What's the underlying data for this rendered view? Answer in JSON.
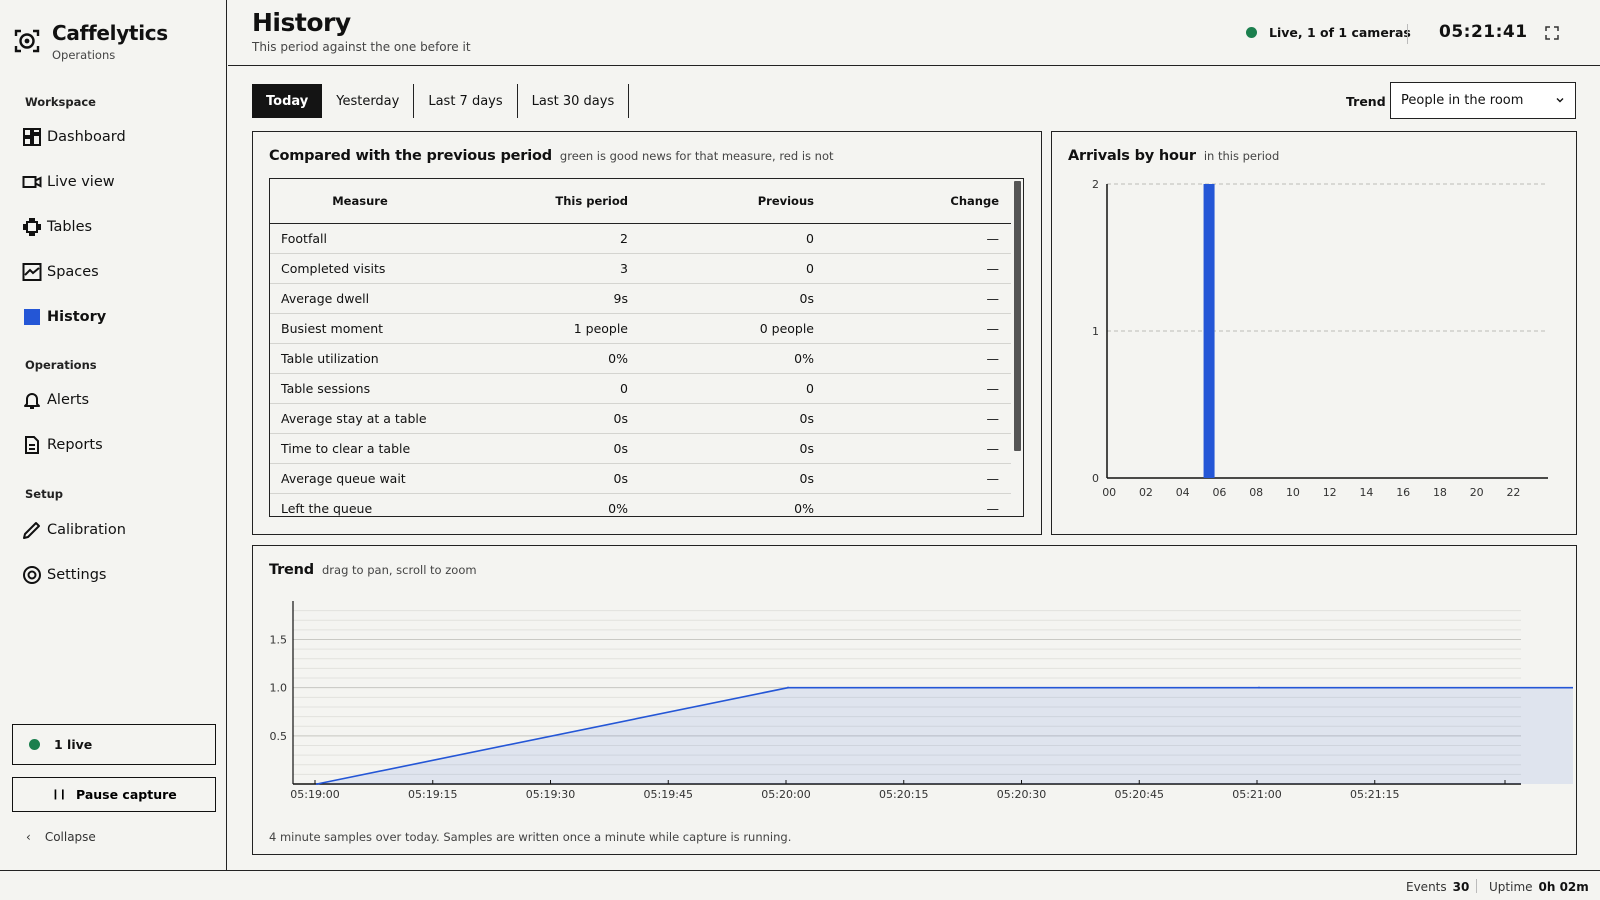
{
  "app": {
    "name": "Caffelytics",
    "subtitle": "Operations"
  },
  "sidebar": {
    "sections": [
      "Workspace",
      "Operations",
      "Setup"
    ],
    "items": [
      {
        "label": "Dashboard",
        "icon": "dashboard-icon"
      },
      {
        "label": "Live view",
        "icon": "camera-icon"
      },
      {
        "label": "Tables",
        "icon": "table-icon"
      },
      {
        "label": "Spaces",
        "icon": "chart-area-icon"
      },
      {
        "label": "History",
        "icon": "history-square-icon",
        "active": true
      },
      {
        "label": "Alerts",
        "icon": "bell-icon"
      },
      {
        "label": "Reports",
        "icon": "document-icon"
      },
      {
        "label": "Calibration",
        "icon": "pencil-icon"
      },
      {
        "label": "Settings",
        "icon": "settings-icon"
      }
    ],
    "live_count": "1 live",
    "pause_label": "Pause capture",
    "collapse_label": "Collapse"
  },
  "header": {
    "title": "History",
    "subtitle": "This period against the one before it",
    "live_status": "Live, 1 of 1 cameras",
    "clock": "05:21:41"
  },
  "tabs": [
    "Today",
    "Yesterday",
    "Last 7 days",
    "Last 30 days"
  ],
  "trend_selector": {
    "label": "Trend",
    "value": "People in the room"
  },
  "comparison": {
    "title": "Compared with the previous period",
    "note": "green is good news for that measure, red is not",
    "columns": [
      "Measure",
      "This period",
      "Previous",
      "Change"
    ],
    "rows": [
      [
        "Footfall",
        "2",
        "0",
        "—"
      ],
      [
        "Completed visits",
        "3",
        "0",
        "—"
      ],
      [
        "Average dwell",
        "9s",
        "0s",
        "—"
      ],
      [
        "Busiest moment",
        "1 people",
        "0 people",
        "—"
      ],
      [
        "Table utilization",
        "0%",
        "0%",
        "—"
      ],
      [
        "Table sessions",
        "0",
        "0",
        "—"
      ],
      [
        "Average stay at a table",
        "0s",
        "0s",
        "—"
      ],
      [
        "Time to clear a table",
        "0s",
        "0s",
        "—"
      ],
      [
        "Average queue wait",
        "0s",
        "0s",
        "—"
      ],
      [
        "Left the queue",
        "0%",
        "0%",
        "—"
      ]
    ]
  },
  "arrivals": {
    "title": "Arrivals by hour",
    "note": "in this period"
  },
  "trend": {
    "title": "Trend",
    "note": "drag to pan, scroll to zoom",
    "footnote": "4 minute samples over today. Samples are written once a minute while capture is running."
  },
  "statusbar": {
    "events_label": "Events",
    "events_value": "30",
    "uptime_label": "Uptime",
    "uptime_value": "0h 02m"
  },
  "colors": {
    "accent": "#2456d6",
    "live": "#1b7f4e",
    "dark": "#141414"
  },
  "chart_data": [
    {
      "type": "bar",
      "title": "Arrivals by hour",
      "categories": [
        "00",
        "01",
        "02",
        "03",
        "04",
        "05",
        "06",
        "07",
        "08",
        "09",
        "10",
        "11",
        "12",
        "13",
        "14",
        "15",
        "16",
        "17",
        "18",
        "19",
        "20",
        "21",
        "22",
        "23"
      ],
      "tick_labels": [
        "00",
        "02",
        "04",
        "06",
        "08",
        "10",
        "12",
        "14",
        "16",
        "18",
        "20",
        "22"
      ],
      "values": [
        0,
        0,
        0,
        0,
        0,
        2,
        0,
        0,
        0,
        0,
        0,
        0,
        0,
        0,
        0,
        0,
        0,
        0,
        0,
        0,
        0,
        0,
        0,
        0
      ],
      "ylim": [
        0,
        2
      ],
      "yticks": [
        0,
        1,
        2
      ],
      "grid": true
    },
    {
      "type": "area",
      "title": "Trend",
      "x": [
        "05:19:00",
        "05:20:00",
        "05:21:00",
        "05:21:41"
      ],
      "values": [
        0,
        1,
        1,
        1
      ],
      "xticks": [
        "05:19:00",
        "05:19:15",
        "05:19:30",
        "05:19:45",
        "05:20:00",
        "05:20:15",
        "05:20:30",
        "05:20:45",
        "05:21:00",
        "05:21:15"
      ],
      "yticks": [
        "0.5",
        "1.0",
        "1.5"
      ],
      "ylim": [
        0,
        1.9
      ],
      "grid": true
    }
  ]
}
